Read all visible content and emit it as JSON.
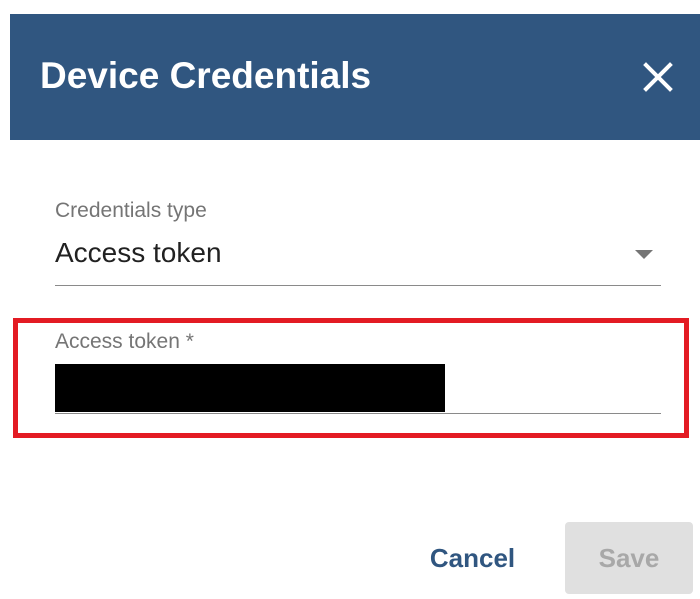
{
  "dialog": {
    "title": "Device Credentials",
    "close_icon": "close-icon"
  },
  "form": {
    "credentials_type": {
      "label": "Credentials type",
      "value": "Access token",
      "icon": "dropdown-arrow-icon"
    },
    "access_token": {
      "label": "Access token *",
      "value": "",
      "redacted": true
    }
  },
  "actions": {
    "cancel_label": "Cancel",
    "save_label": "Save",
    "save_disabled": true
  },
  "colors": {
    "header_background": "#305680",
    "highlight_border": "#e31b23",
    "primary_text": "#305680",
    "disabled_background": "#e0e0e0",
    "disabled_text": "#a8a8a8"
  }
}
